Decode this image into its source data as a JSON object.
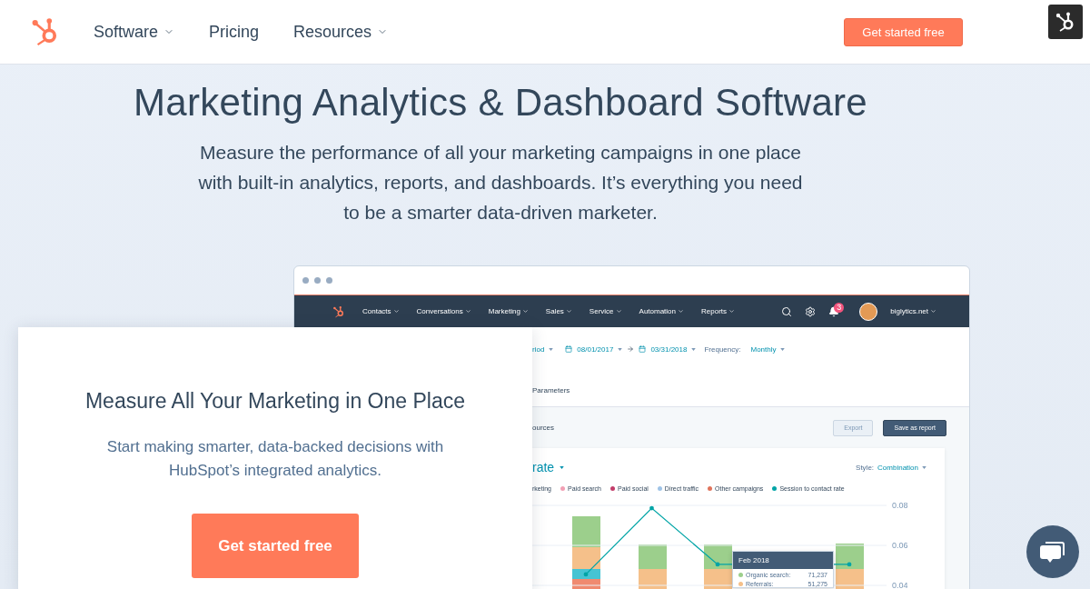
{
  "header": {
    "nav": [
      {
        "label": "Software",
        "has_menu": true
      },
      {
        "label": "Pricing",
        "has_menu": false
      },
      {
        "label": "Resources",
        "has_menu": true
      }
    ],
    "cta": "Get started free"
  },
  "hero": {
    "title": "Marketing Analytics & Dashboard Software",
    "text": "Measure the performance of all your marketing campaigns in one place with built-in analytics, reports, and dashboards. It’s everything you need to be a smarter data-driven marketer."
  },
  "app": {
    "nav": [
      {
        "label": "Contacts"
      },
      {
        "label": "Conversations"
      },
      {
        "label": "Marketing"
      },
      {
        "label": "Sales"
      },
      {
        "label": "Service"
      },
      {
        "label": "Automation"
      },
      {
        "label": "Reports"
      }
    ],
    "notification_count": "3",
    "account": "biglytics.net",
    "filters": {
      "period": "riod",
      "start": "08/01/2017",
      "end": "03/31/2018",
      "frequency_label": "Frequency:",
      "frequency": "Monthly"
    },
    "tab": "Parameters",
    "section": "ources",
    "buttons": [
      {
        "label": "Export",
        "kind": "secondary"
      },
      {
        "label": "Save as report",
        "kind": "primary"
      }
    ],
    "chart_title": "rate",
    "style_label": "Style:",
    "style_value": "Combination",
    "legend": [
      {
        "label": "rketing"
      },
      {
        "label": "Paid search",
        "color": "#f2a0b4"
      },
      {
        "label": "Paid social",
        "color": "#c23d6a"
      },
      {
        "label": "Direct traffic",
        "color": "#9fc3e7"
      },
      {
        "label": "Other campaigns",
        "color": "#e0745c"
      }
    ],
    "chart_data": {
      "type": "line",
      "ylim": [
        0.04,
        0.08
      ],
      "yticks": [
        0.04,
        0.06,
        0.08
      ],
      "series": [
        {
          "name": "Session to contact rate",
          "color": "#00a4a6",
          "values": [
            0.0455,
            0.0786,
            0.0505,
            null,
            0.0505
          ]
        }
      ]
    },
    "tooltip": {
      "title": "Feb 2018",
      "rows": [
        {
          "label": "Organic search:",
          "value": "71,237",
          "color": "#9ccf8c"
        },
        {
          "label": "Referrals:",
          "value": "51,275",
          "color": "#f5c08a"
        }
      ]
    }
  },
  "card": {
    "title": "Measure All Your Marketing in One Place",
    "text": "Start making smarter, data-backed decisions with HubSpot’s integrated analytics.",
    "cta": "Get started free"
  }
}
